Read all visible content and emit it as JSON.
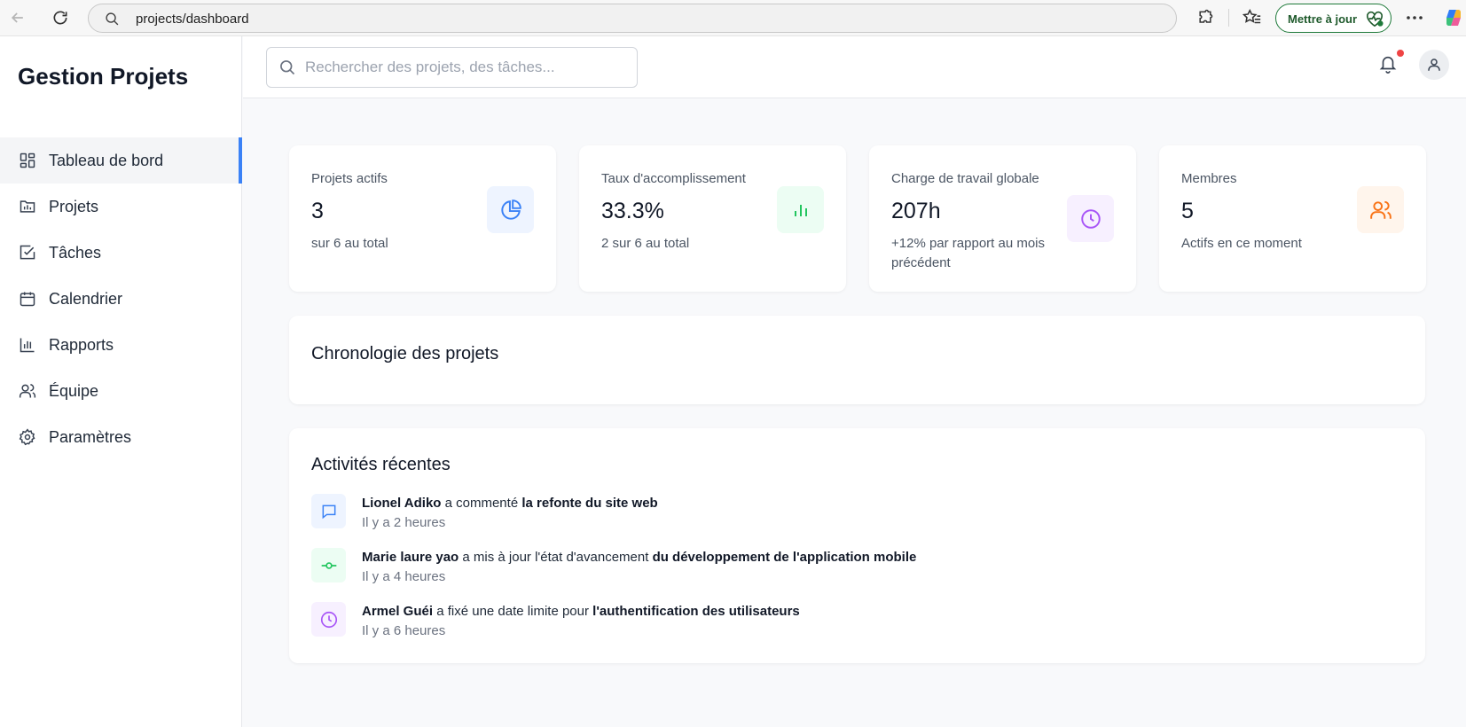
{
  "browser": {
    "url": "projects/dashboard",
    "update_label": "Mettre à jour"
  },
  "sidebar": {
    "brand": "Gestion Projets",
    "items": [
      {
        "label": "Tableau de bord",
        "icon": "dashboard-icon",
        "active": true
      },
      {
        "label": "Projets",
        "icon": "projects-icon"
      },
      {
        "label": "Tâches",
        "icon": "tasks-icon"
      },
      {
        "label": "Calendrier",
        "icon": "calendar-icon"
      },
      {
        "label": "Rapports",
        "icon": "reports-icon"
      },
      {
        "label": "Équipe",
        "icon": "team-icon"
      },
      {
        "label": "Paramètres",
        "icon": "settings-icon"
      }
    ]
  },
  "header": {
    "search_placeholder": "Rechercher des projets, des tâches...",
    "search_value": "",
    "has_notification": true
  },
  "stats": [
    {
      "title": "Projets actifs",
      "value": "3",
      "sub": "sur 6 au total",
      "icon": "pie-chart-icon",
      "color": "#3b82f6",
      "bg": "#eef4ff"
    },
    {
      "title": "Taux d'accomplissement",
      "value": "33.3%",
      "sub": "2 sur 6 au total",
      "icon": "bar-chart-icon",
      "color": "#22c55e",
      "bg": "#ecfdf3"
    },
    {
      "title": "Charge de travail globale",
      "value": "207h",
      "sub": "+12% par rapport au mois précédent",
      "icon": "clock-icon",
      "color": "#a855f7",
      "bg": "#f7f0ff"
    },
    {
      "title": "Membres",
      "value": "5",
      "sub": "Actifs en ce moment",
      "icon": "users-icon",
      "color": "#f97316",
      "bg": "#fff5ec"
    }
  ],
  "timeline": {
    "title": "Chronologie des projets"
  },
  "activity": {
    "title": "Activités récentes",
    "items": [
      {
        "user": "Lionel Adiko",
        "action": "a commenté",
        "target": "la refonte du site web",
        "time": "Il y a 2 heures",
        "icon": "comment-icon",
        "color": "#3b82f6",
        "bg": "#eef4ff"
      },
      {
        "user": "Marie laure yao",
        "action": "a mis à jour l'état d'avancement",
        "target": "du développement de l'application mobile",
        "time": "Il y a 4 heures",
        "icon": "commit-icon",
        "color": "#22c55e",
        "bg": "#ecfdf3"
      },
      {
        "user": "Armel Guéi",
        "action": "a fixé une date limite pour",
        "target": "l'authentification des utilisateurs",
        "time": "Il y a 6 heures",
        "icon": "clock-icon",
        "color": "#a855f7",
        "bg": "#f7f0ff"
      }
    ]
  }
}
